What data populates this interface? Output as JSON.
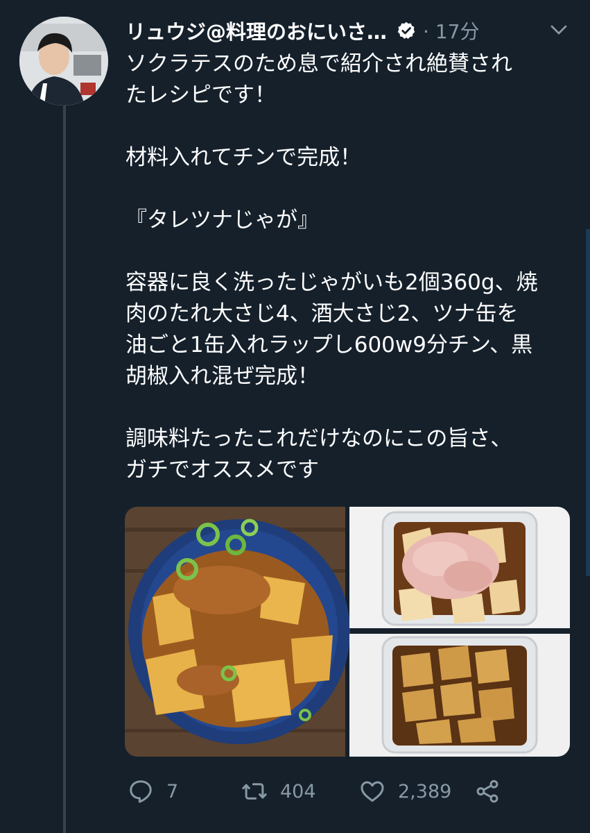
{
  "tweet": {
    "author_name": "リュウジ@料理のおにいさ…",
    "time_separator": "·",
    "time": "17分",
    "paragraphs": [
      [
        "ソクラテスのため息で紹介され絶賛され",
        "たレシピです！"
      ],
      [
        "材料入れてチンで完成！"
      ],
      [
        "『タレツナじゃが』"
      ],
      [
        "容器に良く洗ったじゃがいも2個360g、焼",
        "肉のたれ大さじ4、酒大さじ2、ツナ缶を",
        "油ごと1缶入れラップし600w9分チン、黒",
        "胡椒入れ混ぜ完成！"
      ],
      [
        "調味料たったこれだけなのにこの旨さ、",
        "ガチでオススメです"
      ]
    ]
  },
  "actions": {
    "reply_count": "7",
    "retweet_count": "404",
    "like_count": "2,389"
  },
  "icons": [
    "verified-badge-icon",
    "chevron-down-icon",
    "reply-icon",
    "retweet-icon",
    "like-icon",
    "share-icon"
  ],
  "colors": {
    "background": "#15202b",
    "secondary_text": "#8899a6",
    "thread_line": "#38444d"
  }
}
